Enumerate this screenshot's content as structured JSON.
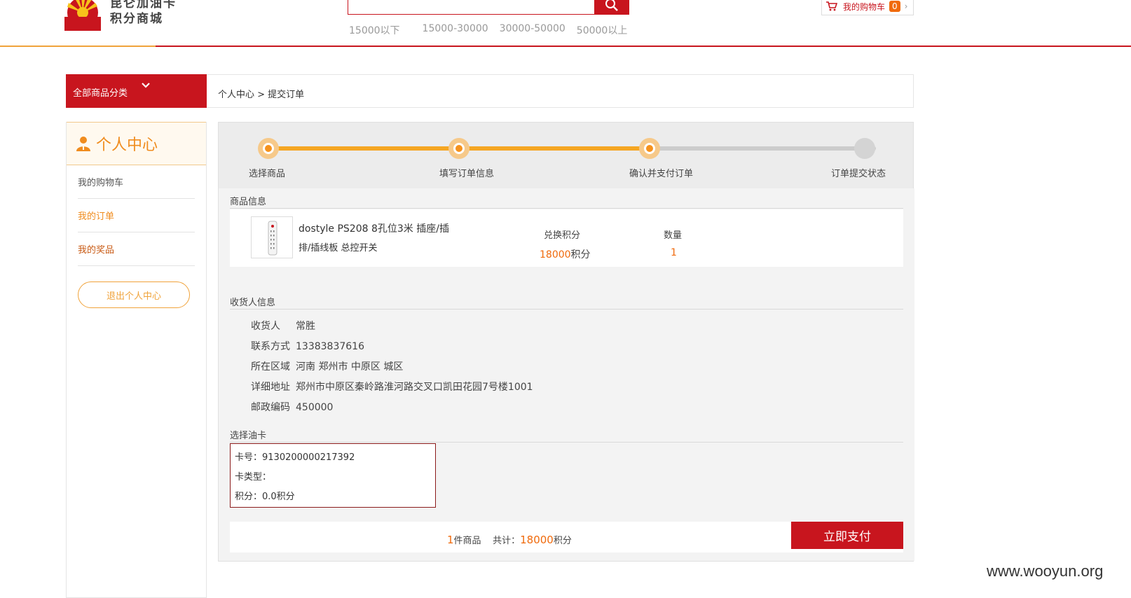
{
  "header": {
    "logo_line1": "昆仑加油卡",
    "logo_line2": "积分商城",
    "search_placeholder": "",
    "price_filters": [
      "15000以下",
      "15000-30000",
      "30000-50000",
      "50000以上"
    ],
    "cart_label": "我的购物车",
    "cart_count": "0"
  },
  "nav": {
    "category_label": "全部商品分类",
    "breadcrumb": "个人中心 > 提交订单"
  },
  "sidebar": {
    "title": "个人中心",
    "items": [
      "我的购物车",
      "我的订单",
      "我的奖品"
    ],
    "logout_label": "退出个人中心"
  },
  "steps": [
    {
      "label": "选择商品",
      "status": "done"
    },
    {
      "label": "填写订单信息",
      "status": "done"
    },
    {
      "label": "确认并支付订单",
      "status": "done"
    },
    {
      "label": "订单提交状态",
      "status": "todo"
    }
  ],
  "product": {
    "section_title": "商品信息",
    "name_line1": "dostyle PS208 8孔位3米 插座/插",
    "name_line2": "排/插线板 总控开关",
    "points_header": "兑换积分",
    "points_value": "18000",
    "points_unit": "积分",
    "qty_header": "数量",
    "qty_value": "1"
  },
  "receiver": {
    "section_title": "收货人信息",
    "rows": [
      {
        "label": "收货人",
        "value": "常胜"
      },
      {
        "label": "联系方式",
        "value": "13383837616"
      },
      {
        "label": "所在区域",
        "value": "河南 郑州市 中原区 城区"
      },
      {
        "label": "详细地址",
        "value": "郑州市中原区秦岭路淮河路交叉口凯田花园7号楼1001"
      },
      {
        "label": "邮政编码",
        "value": "450000"
      }
    ]
  },
  "oil_card": {
    "section_title": "选择油卡",
    "card_no": "卡号：9130200000217392",
    "card_type": "卡类型：",
    "card_points": "积分：0.0积分"
  },
  "payment": {
    "count": "1",
    "count_suffix": "件商品",
    "total_label": "共计：",
    "total_value": "18000",
    "total_unit": "积分",
    "pay_label": "立即支付"
  },
  "watermark": "www.wooyun.org",
  "colors": {
    "brand_red": "#c8151e",
    "accent_orange": "#f5921e",
    "price_orange": "#f06a0c"
  }
}
